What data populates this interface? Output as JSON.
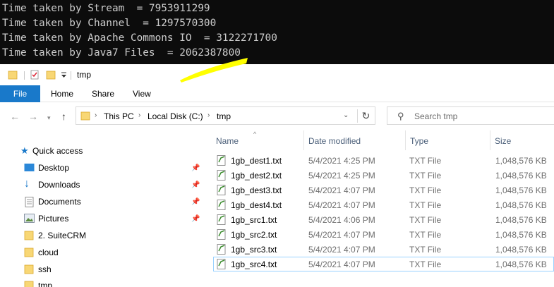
{
  "console": {
    "lines": [
      "Time taken by Stream  = 7953911299",
      "Time taken by Channel  = 1297570300",
      "Time taken by Apache Commons IO  = 3122271700",
      "Time taken by Java7 Files  = 2062387800"
    ]
  },
  "window": {
    "title": "tmp"
  },
  "ribbon": {
    "file": "File",
    "home": "Home",
    "share": "Share",
    "view": "View"
  },
  "address": {
    "crumbs": [
      "This PC",
      "Local Disk (C:)",
      "tmp"
    ]
  },
  "search": {
    "placeholder": "Search tmp"
  },
  "navpane": {
    "quick_access": "Quick access",
    "items": [
      "Desktop",
      "Downloads",
      "Documents",
      "Pictures",
      "2. SuiteCRM",
      "cloud",
      "ssh",
      "tmp"
    ]
  },
  "columns": {
    "name": "Name",
    "date": "Date modified",
    "type": "Type",
    "size": "Size"
  },
  "files": [
    {
      "name": "1gb_dest1.txt",
      "date": "5/4/2021 4:25 PM",
      "type": "TXT File",
      "size": "1,048,576 KB"
    },
    {
      "name": "1gb_dest2.txt",
      "date": "5/4/2021 4:25 PM",
      "type": "TXT File",
      "size": "1,048,576 KB"
    },
    {
      "name": "1gb_dest3.txt",
      "date": "5/4/2021 4:07 PM",
      "type": "TXT File",
      "size": "1,048,576 KB"
    },
    {
      "name": "1gb_dest4.txt",
      "date": "5/4/2021 4:07 PM",
      "type": "TXT File",
      "size": "1,048,576 KB"
    },
    {
      "name": "1gb_src1.txt",
      "date": "5/4/2021 4:06 PM",
      "type": "TXT File",
      "size": "1,048,576 KB"
    },
    {
      "name": "1gb_src2.txt",
      "date": "5/4/2021 4:07 PM",
      "type": "TXT File",
      "size": "1,048,576 KB"
    },
    {
      "name": "1gb_src3.txt",
      "date": "5/4/2021 4:07 PM",
      "type": "TXT File",
      "size": "1,048,576 KB"
    },
    {
      "name": "1gb_src4.txt",
      "date": "5/4/2021 4:07 PM",
      "type": "TXT File",
      "size": "1,048,576 KB"
    }
  ],
  "colors": {
    "accent": "#1979ca",
    "console_bg": "#0c0c0c",
    "highlight": "#ffff00",
    "selection_border": "#99d1ff"
  }
}
